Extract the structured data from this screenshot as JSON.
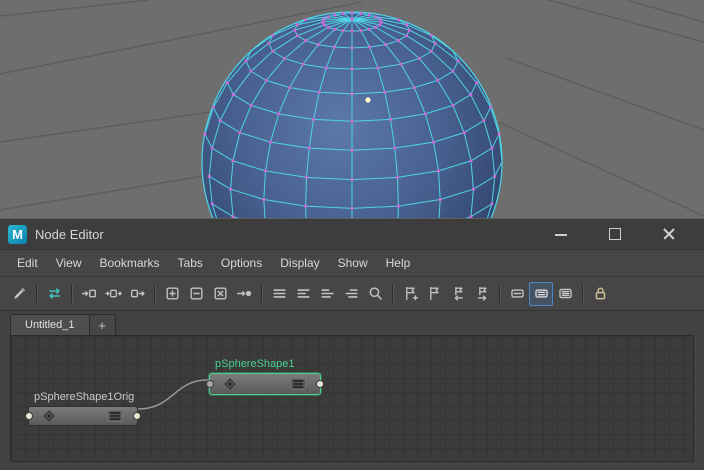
{
  "window": {
    "app_icon_letter": "M",
    "title": "Node Editor",
    "controls": [
      "minimize",
      "maximize",
      "close"
    ]
  },
  "menu": {
    "items": [
      "Edit",
      "View",
      "Bookmarks",
      "Tabs",
      "Options",
      "Display",
      "Show",
      "Help"
    ]
  },
  "toolbar": {
    "icons": [
      "create-node",
      "sync-graph",
      "add-input-connections",
      "add-input-and-output-connections",
      "add-output-connections",
      "add-selected-nodes-to-graph",
      "remove-selected-nodes-from-graph",
      "clear-graph",
      "pin-selection",
      "layout-rows",
      "layout-rows-alt",
      "align-left",
      "align-right",
      "search",
      "create-bookmark",
      "edit-bookmarks",
      "previous-bookmark",
      "next-bookmark",
      "simple-display-mode",
      "connected-display-mode",
      "full-display-mode",
      "lock-node-editor"
    ],
    "active_icon": "connected-display-mode"
  },
  "tabs": {
    "active": "Untitled_1",
    "add": "+"
  },
  "graph": {
    "nodes": [
      {
        "label": "pSphereShape1Orig",
        "selected": false
      },
      {
        "label": "pSphereShape1",
        "selected": true
      }
    ]
  },
  "colors": {
    "wireframe": "#4fd4e4",
    "vertex": "#c869d8",
    "vertex_highlight": "#ffffc8",
    "selected_node": "#49d18d",
    "toolbar_active": "#4a86c8",
    "maya_icon": "#18a7c4",
    "viewport_background": "#6e6e6e"
  }
}
